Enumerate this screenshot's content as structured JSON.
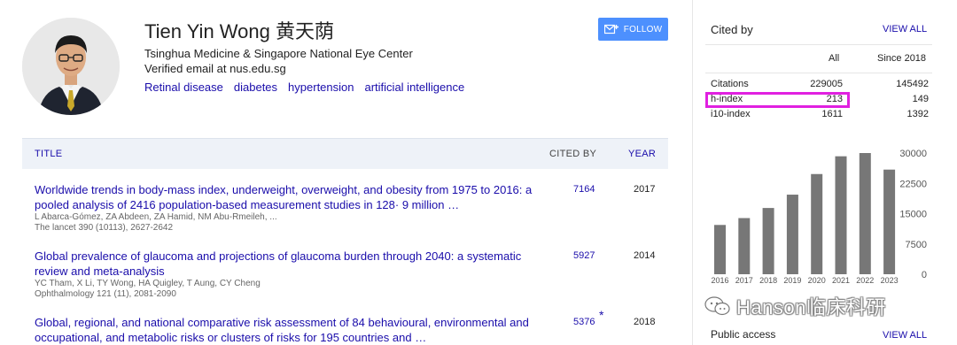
{
  "profile": {
    "name": "Tien Yin Wong 黄天荫",
    "affiliation": "Tsinghua Medicine & Singapore National Eye Center",
    "email": "Verified email at nus.edu.sg",
    "interests": [
      "Retinal disease",
      "diabetes",
      "hypertension",
      "artificial intelligence"
    ],
    "follow_label": "FOLLOW"
  },
  "table": {
    "headers": {
      "title": "TITLE",
      "cited_by": "CITED BY",
      "year": "YEAR"
    },
    "articles": [
      {
        "title": "Worldwide trends in body-mass index, underweight, overweight, and obesity from 1975 to 2016: a pooled analysis of 2416 population-based measurement studies in 128· 9 million …",
        "authors": "L Abarca-Gómez, ZA Abdeen, ZA Hamid, NM Abu-Rmeileh, ...",
        "venue": "The lancet 390 (10113), 2627-2642",
        "cited_by": "7164",
        "year": "2017"
      },
      {
        "title": "Global prevalence of glaucoma and projections of glaucoma burden through 2040: a systematic review and meta-analysis",
        "authors": "YC Tham, X Li, TY Wong, HA Quigley, T Aung, CY Cheng",
        "venue": "Ophthalmology 121 (11), 2081-2090",
        "cited_by": "5927",
        "year": "2014"
      },
      {
        "title": "Global, regional, and national comparative risk assessment of 84 behavioural, environmental and occupational, and metabolic risks or clusters of risks for 195 countries and …",
        "cited_by": "5376",
        "star": "*",
        "year": "2018"
      }
    ]
  },
  "cited_by": {
    "title": "Cited by",
    "view_all": "VIEW ALL",
    "col_all": "All",
    "col_since": "Since 2018",
    "rows": [
      {
        "label": "Citations",
        "all": "229005",
        "since": "145492"
      },
      {
        "label": "h-index",
        "all": "213",
        "since": "149"
      },
      {
        "label": "i10-index",
        "all": "1611",
        "since": "1392"
      }
    ],
    "highlight_color": "#e020e0"
  },
  "chart_data": {
    "type": "bar",
    "categories": [
      "2016",
      "2017",
      "2018",
      "2019",
      "2020",
      "2021",
      "2022",
      "2023"
    ],
    "values": [
      12200,
      13900,
      16400,
      19700,
      24800,
      29200,
      30000,
      25900
    ],
    "yticks": [
      "30000",
      "22500",
      "15000",
      "7500",
      "0"
    ],
    "ylim": [
      0,
      30000
    ],
    "bar_color": "#777777",
    "grid": false
  },
  "watermark": {
    "text": "Hanson临床科研"
  },
  "public_access": {
    "title": "Public access",
    "view_all": "VIEW ALL"
  },
  "colors": {
    "link": "#1a0dab",
    "follow_button": "#4d90fe",
    "table_header_bg": "#eef2f8"
  }
}
